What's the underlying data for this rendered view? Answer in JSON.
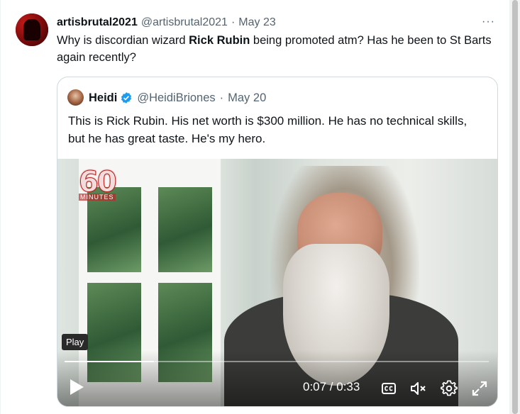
{
  "tweet": {
    "display_name": "artisbrutal2021",
    "handle": "@artisbrutal2021",
    "separator": "·",
    "date": "May 23",
    "more_label": "···",
    "text_before": "Why is discordian wizard ",
    "text_bold": "Rick Rubin",
    "text_after": " being promoted atm?  Has he been to St Barts again recently?"
  },
  "quote": {
    "display_name": "Heidi",
    "handle": "@HeidiBriones",
    "separator": "·",
    "date": "May 20",
    "text": "This is Rick Rubin. His net worth is $300 million. He has no technical skills, but he has great taste. He's my hero."
  },
  "video": {
    "logo_number": "60",
    "logo_word": "MINUTES",
    "tooltip": "Play",
    "time_display": "0:07 / 0:33",
    "progress": 0.21,
    "icons": [
      "play-icon",
      "captions-icon",
      "muted-speaker-icon",
      "settings-icon",
      "fullscreen-icon"
    ]
  },
  "colors": {
    "text": "#0f1419",
    "secondary": "#536471",
    "verified": "#1d9bf0",
    "border": "#cfd9de"
  }
}
